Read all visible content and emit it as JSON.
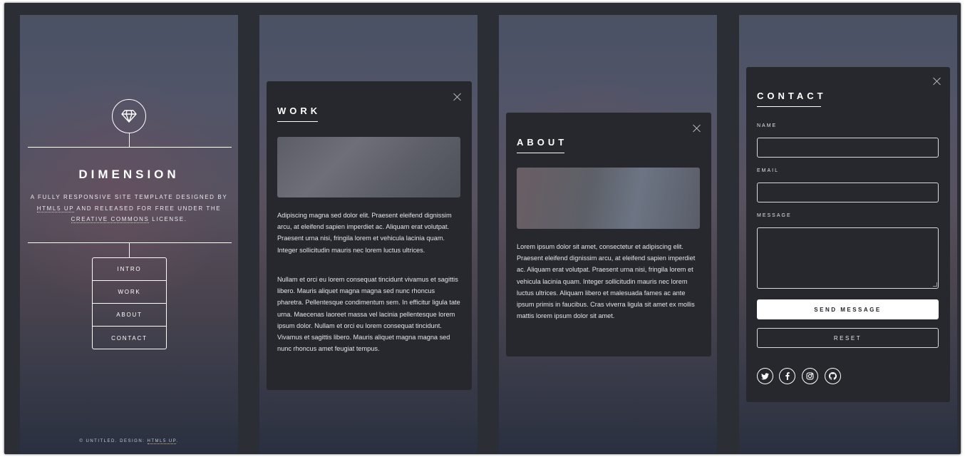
{
  "intro": {
    "title": "DIMENSION",
    "tagline_line1": "A FULLY RESPONSIVE SITE TEMPLATE DESIGNED BY",
    "tagline_link1": "HTML5 UP",
    "tagline_line2_rest": " AND RELEASED FOR FREE UNDER THE",
    "tagline_link2": "CREATIVE COMMONS",
    "tagline_line3_rest": " LICENSE.",
    "nav": [
      "INTRO",
      "WORK",
      "ABOUT",
      "CONTACT"
    ],
    "footer_text": "© UNTITLED. DESIGN: ",
    "footer_link": "HTML5 UP",
    "footer_end": ".",
    "logo_icon": "diamond-icon"
  },
  "work": {
    "heading": "WORK",
    "para1": "Adipiscing magna sed dolor elit. Praesent eleifend dignissim arcu, at eleifend sapien imperdiet ac. Aliquam erat volutpat. Praesent urna nisi, fringila lorem et vehicula lacinia quam. Integer sollicitudin mauris nec lorem luctus ultrices.",
    "para2": "Nullam et orci eu lorem consequat tincidunt vivamus et sagittis libero. Mauris aliquet magna magna sed nunc rhoncus pharetra. Pellentesque condimentum sem. In efficitur ligula tate urna. Maecenas laoreet massa vel lacinia pellentesque lorem ipsum dolor. Nullam et orci eu lorem consequat tincidunt. Vivamus et sagittis libero. Mauris aliquet magna magna sed nunc rhoncus amet feugiat tempus."
  },
  "about": {
    "heading": "ABOUT",
    "para1": "Lorem ipsum dolor sit amet, consectetur et adipiscing elit. Praesent eleifend dignissim arcu, at eleifend sapien imperdiet ac. Aliquam erat volutpat. Praesent urna nisi, fringila lorem et vehicula lacinia quam. Integer sollicitudin mauris nec lorem luctus ultrices. Aliquam libero et malesuada fames ac ante ipsum primis in faucibus. Cras viverra ligula sit amet ex mollis mattis lorem ipsum dolor sit amet."
  },
  "contact": {
    "heading": "CONTACT",
    "name_label": "NAME",
    "email_label": "EMAIL",
    "message_label": "MESSAGE",
    "name_value": "",
    "email_value": "",
    "message_value": "",
    "send_label": "SEND MESSAGE",
    "reset_label": "RESET",
    "social_icons": [
      "twitter-icon",
      "facebook-icon",
      "instagram-icon",
      "github-icon"
    ]
  },
  "colors": {
    "article_bg": "#27282d",
    "frame_bg": "#2c2e35",
    "accent": "#ffffff"
  }
}
